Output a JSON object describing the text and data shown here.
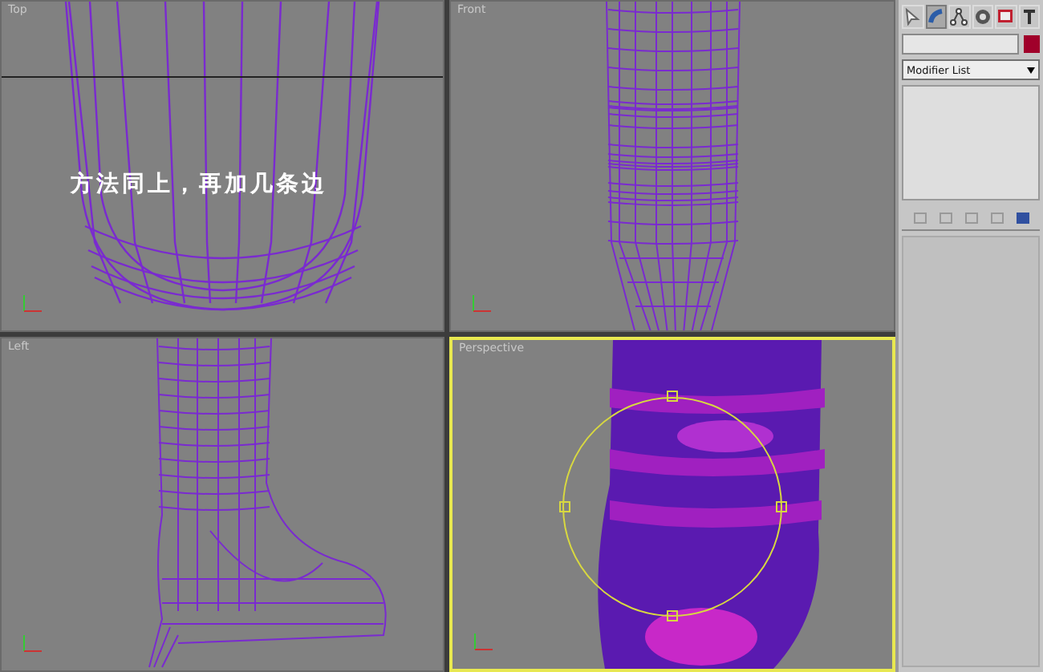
{
  "viewports": [
    {
      "label": "Top",
      "kind": "top",
      "active": false,
      "annotation": "方法同上，再加几条边"
    },
    {
      "label": "Front",
      "kind": "front",
      "active": false
    },
    {
      "label": "Left",
      "kind": "left",
      "active": false
    },
    {
      "label": "Perspective",
      "kind": "perspective",
      "active": true
    }
  ],
  "command_panel": {
    "tabs": [
      {
        "selected": false
      },
      {
        "selected": true
      },
      {
        "selected": false
      },
      {
        "selected": false
      },
      {
        "selected": false
      },
      {
        "selected": false
      }
    ],
    "modifier_list": "Modifier List"
  }
}
